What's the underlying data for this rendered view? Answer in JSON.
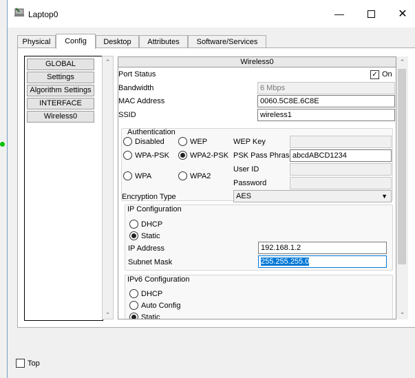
{
  "window": {
    "title": "Laptop0"
  },
  "tabs": [
    "Physical",
    "Config",
    "Desktop",
    "Attributes",
    "Software/Services"
  ],
  "left_menu": [
    "GLOBAL",
    "Settings",
    "Algorithm Settings",
    "INTERFACE",
    "Wireless0"
  ],
  "pane": {
    "title": "Wireless0",
    "port_status_label": "Port Status",
    "on_label": "On",
    "on_checked": true,
    "bandwidth_label": "Bandwidth",
    "bandwidth_value": "6 Mbps",
    "mac_label": "MAC Address",
    "mac_value": "0060.5C8E.6C8E",
    "ssid_label": "SSID",
    "ssid_value": "wireless1",
    "auth": {
      "legend": "Authentication",
      "disabled": "Disabled",
      "wep": "WEP",
      "wpa_psk": "WPA-PSK",
      "wpa2_psk": "WPA2-PSK",
      "wpa": "WPA",
      "wpa2": "WPA2",
      "selected": "WPA2-PSK",
      "wep_key_label": "WEP Key",
      "psk_label": "PSK Pass Phrase",
      "psk_value": "abcdABCD1234",
      "user_id_label": "User ID",
      "password_label": "Password"
    },
    "encryption_label": "Encryption Type",
    "encryption_value": "AES",
    "ip": {
      "legend": "IP Configuration",
      "dhcp": "DHCP",
      "static": "Static",
      "selected": "Static",
      "ip_label": "IP Address",
      "ip_value": "192.168.1.2",
      "mask_label": "Subnet Mask",
      "mask_value": "255.255.255.0"
    },
    "ipv6": {
      "legend": "IPv6 Configuration",
      "dhcp": "DHCP",
      "auto": "Auto Config",
      "static": "Static",
      "selected": "Static"
    }
  },
  "footer": {
    "top_label": "Top"
  },
  "colors": {
    "accent": "#0078d7",
    "status_dot": "#00c000"
  }
}
